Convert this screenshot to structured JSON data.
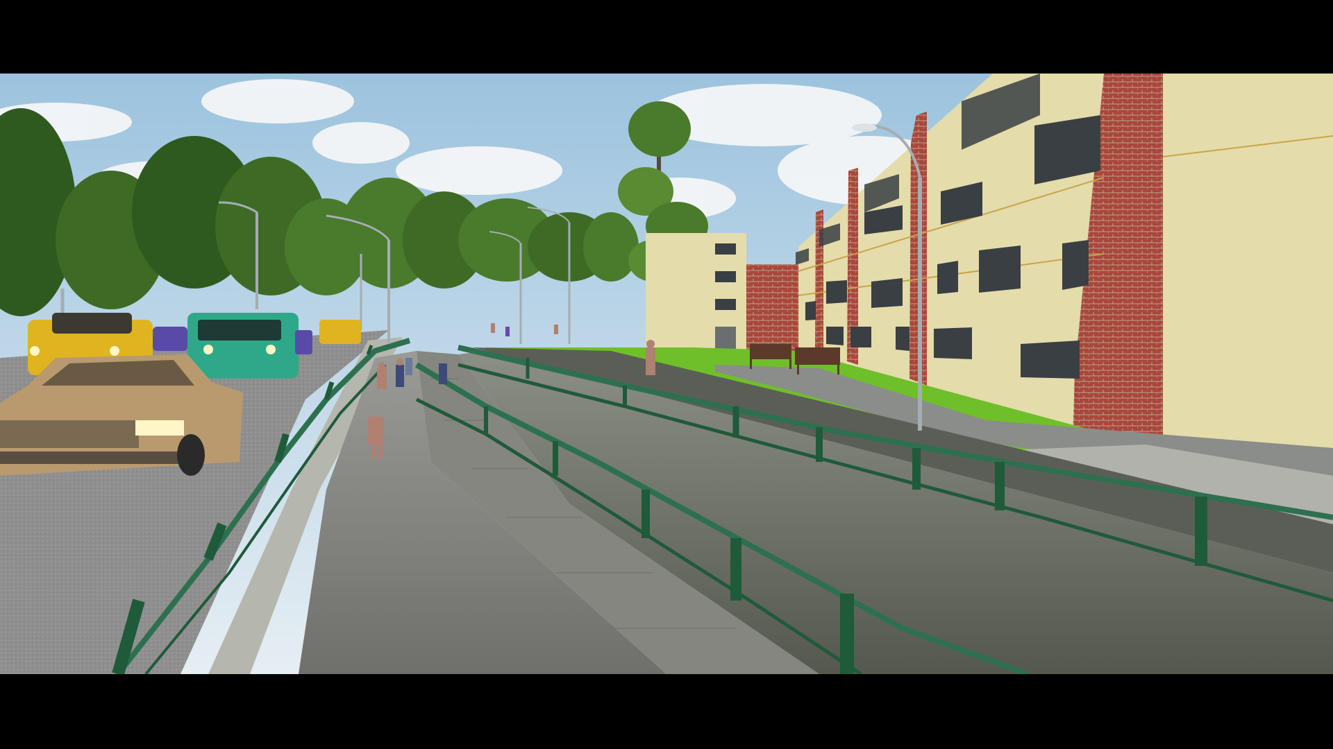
{
  "scene": {
    "description_free": true,
    "colors": {
      "letterbox": "#000000",
      "sky_top": "#9cc3de",
      "sky_bottom": "#e6eef3",
      "cloud": "#f4f6f8",
      "tree_dark": "#2f5a1f",
      "tree_mid": "#4a7a2c",
      "tree_light": "#6d9a3a",
      "grass": "#6fbf2a",
      "grass_dark": "#5aa322",
      "road": "#8d8d8d",
      "pavement": "#a9a9a9",
      "ramp": "#7a7b78",
      "wall_concrete": "#bdbdb8",
      "railing": "#1f5a3a",
      "railing_top": "#2d7050",
      "building_wall": "#e4dcaa",
      "brick": "#a8473a",
      "window": "#3a3f44",
      "lamp_pole": "#a5adb3",
      "car_beige": "#b99a6e",
      "car_yellow": "#e0b420",
      "car_teal": "#2fa88a",
      "car_purple": "#5a4aa8",
      "headlight": "#fff6c8",
      "bench": "#5b3a2a",
      "person": "#b08070"
    }
  }
}
